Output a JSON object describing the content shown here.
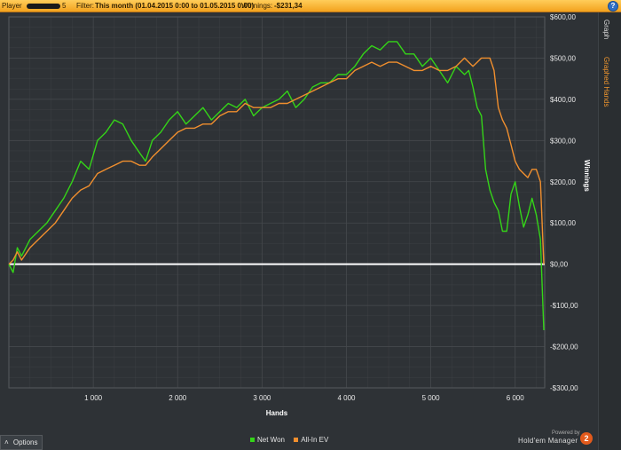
{
  "header": {
    "player_label": "Player",
    "player_suffix": "5",
    "filter_label": "Filter:",
    "filter_value": "This month (01.04.2015 0:00 to 01.05.2015 0:00)",
    "winnings_label": "Winnings:",
    "winnings_value": "-$231,34",
    "help_icon": "help-icon",
    "help_glyph": "?"
  },
  "side_tabs": {
    "graph": "Graph",
    "graphed_hands": "Graphed Hands"
  },
  "options": {
    "label": "Options",
    "icon": "chevron-up-icon",
    "glyph": "˄"
  },
  "branding": {
    "powered_by": "Powered by",
    "product": "Hold'em Manager",
    "badge": "2"
  },
  "colors": {
    "background": "#2e3236",
    "grid": "#46494d",
    "net_won": "#34d418",
    "all_in_ev": "#f18f2e",
    "zero_line": "#ffffff",
    "header": "#f5b133"
  },
  "chart_data": {
    "type": "line",
    "xlabel": "Hands",
    "ylabel": "Winnings",
    "xlim": [
      0,
      6350
    ],
    "ylim": [
      -300,
      600
    ],
    "xticks": [
      1000,
      2000,
      3000,
      4000,
      5000,
      6000
    ],
    "xtick_labels": [
      "1 000",
      "2 000",
      "3 000",
      "4 000",
      "5 000",
      "6 000"
    ],
    "yticks": [
      600,
      500,
      400,
      300,
      200,
      100,
      0,
      -100,
      -200,
      -300
    ],
    "ytick_labels": [
      "$600,00",
      "$500,00",
      "$400,00",
      "$300,00",
      "$200,00",
      "$100,00",
      "$0,00",
      "-$100,00",
      "-$200,00",
      "-$300,00"
    ],
    "grid": true,
    "legend_position": "bottom-center",
    "series": [
      {
        "name": "Net Won",
        "color": "#34d418",
        "x": [
          0,
          50,
          100,
          150,
          250,
          350,
          450,
          550,
          650,
          750,
          850,
          950,
          1050,
          1150,
          1250,
          1350,
          1450,
          1550,
          1620,
          1700,
          1800,
          1900,
          2000,
          2100,
          2200,
          2300,
          2400,
          2500,
          2600,
          2700,
          2800,
          2900,
          3000,
          3100,
          3200,
          3300,
          3400,
          3500,
          3600,
          3700,
          3800,
          3900,
          4000,
          4100,
          4200,
          4300,
          4400,
          4500,
          4600,
          4700,
          4800,
          4900,
          5000,
          5100,
          5200,
          5300,
          5400,
          5450,
          5500,
          5550,
          5600,
          5650,
          5700,
          5750,
          5800,
          5850,
          5900,
          5950,
          6000,
          6050,
          6100,
          6150,
          6200,
          6250,
          6300,
          6320,
          6340
        ],
        "y": [
          0,
          -20,
          40,
          20,
          60,
          80,
          100,
          130,
          160,
          200,
          250,
          230,
          300,
          320,
          350,
          340,
          300,
          270,
          250,
          300,
          320,
          350,
          370,
          340,
          360,
          380,
          350,
          370,
          390,
          380,
          400,
          360,
          380,
          390,
          400,
          420,
          380,
          400,
          430,
          440,
          440,
          460,
          460,
          480,
          510,
          530,
          520,
          540,
          540,
          510,
          510,
          480,
          500,
          470,
          440,
          480,
          460,
          470,
          430,
          380,
          360,
          230,
          180,
          150,
          130,
          80,
          80,
          170,
          200,
          140,
          90,
          120,
          160,
          120,
          60,
          -50,
          -160
        ]
      },
      {
        "name": "All-In EV",
        "color": "#f18f2e",
        "x": [
          0,
          50,
          100,
          150,
          250,
          350,
          450,
          550,
          650,
          750,
          850,
          950,
          1050,
          1150,
          1250,
          1350,
          1450,
          1550,
          1620,
          1700,
          1800,
          1900,
          2000,
          2100,
          2200,
          2300,
          2400,
          2500,
          2600,
          2700,
          2800,
          2900,
          3000,
          3100,
          3200,
          3300,
          3400,
          3500,
          3600,
          3700,
          3800,
          3900,
          4000,
          4100,
          4200,
          4300,
          4400,
          4500,
          4600,
          4700,
          4800,
          4900,
          5000,
          5100,
          5200,
          5300,
          5400,
          5450,
          5500,
          5550,
          5600,
          5650,
          5700,
          5750,
          5800,
          5850,
          5900,
          5950,
          6000,
          6050,
          6100,
          6150,
          6200,
          6250,
          6300,
          6320,
          6340
        ],
        "y": [
          0,
          10,
          30,
          10,
          40,
          60,
          80,
          100,
          130,
          160,
          180,
          190,
          220,
          230,
          240,
          250,
          250,
          240,
          240,
          260,
          280,
          300,
          320,
          330,
          330,
          340,
          340,
          360,
          370,
          370,
          390,
          380,
          380,
          380,
          390,
          390,
          400,
          410,
          420,
          430,
          440,
          450,
          450,
          470,
          480,
          490,
          480,
          490,
          490,
          480,
          470,
          470,
          480,
          470,
          470,
          480,
          500,
          490,
          480,
          490,
          500,
          500,
          500,
          470,
          380,
          350,
          330,
          290,
          250,
          230,
          220,
          210,
          230,
          230,
          200,
          100,
          0
        ]
      }
    ]
  }
}
